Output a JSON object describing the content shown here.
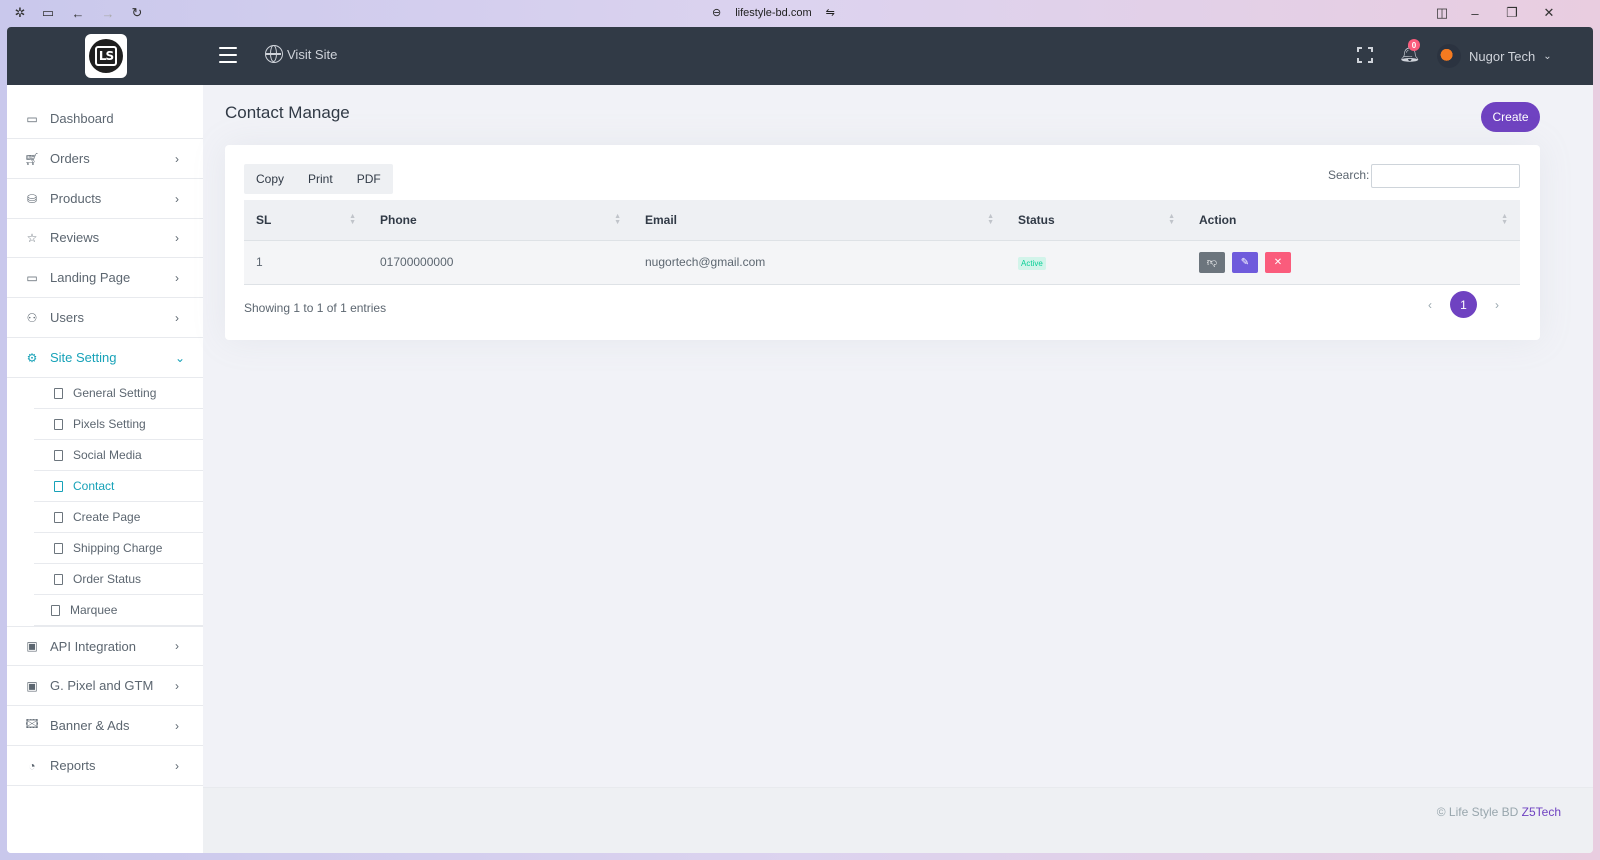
{
  "browser": {
    "url": "lifestyle-bd.com",
    "icons": [
      "extensions-icon",
      "sidebar-toggle-icon",
      "back-icon",
      "forward-icon",
      "reload-icon",
      "link-icon",
      "site-settings-icon",
      "split-view-icon",
      "minimize-icon",
      "restore-icon",
      "close-icon"
    ]
  },
  "topbar": {
    "logo_text": "LS",
    "visit_site": "Visit Site",
    "notification_count": "0",
    "user_name": "Nugor Tech",
    "user_caret": "⌄"
  },
  "sidebar": {
    "items": [
      {
        "label": "Dashboard",
        "icon": "monitor-icon",
        "chevron": ""
      },
      {
        "label": "Orders",
        "icon": "cart-icon",
        "chevron": "›"
      },
      {
        "label": "Products",
        "icon": "database-icon",
        "chevron": "›"
      },
      {
        "label": "Reviews",
        "icon": "star-icon",
        "chevron": "›"
      },
      {
        "label": "Landing Page",
        "icon": "monitor-icon",
        "chevron": "›"
      },
      {
        "label": "Users",
        "icon": "user-icon",
        "chevron": "›"
      },
      {
        "label": "Site Setting",
        "icon": "gear-icon",
        "chevron": "⌄"
      },
      {
        "label": "API Integration",
        "icon": "save-icon",
        "chevron": "›"
      },
      {
        "label": "G. Pixel and GTM",
        "icon": "save-icon",
        "chevron": "›"
      },
      {
        "label": "Banner & Ads",
        "icon": "image-icon",
        "chevron": "›"
      },
      {
        "label": "Reports",
        "icon": "pie-chart-icon",
        "chevron": "›"
      }
    ],
    "subitems": [
      {
        "label": "General Setting"
      },
      {
        "label": "Pixels Setting"
      },
      {
        "label": "Social Media"
      },
      {
        "label": "Contact"
      },
      {
        "label": "Create Page"
      },
      {
        "label": "Shipping Charge"
      },
      {
        "label": "Order Status"
      },
      {
        "label": "Marquee"
      }
    ]
  },
  "main": {
    "title": "Contact Manage",
    "create_label": "Create",
    "export_buttons": [
      "Copy",
      "Print",
      "PDF"
    ],
    "search_label": "Search:",
    "search_value": "",
    "columns": [
      "SL",
      "Phone",
      "Email",
      "Status",
      "Action"
    ],
    "rows": [
      {
        "sl": "1",
        "phone": "01700000000",
        "email": "nugortech@gmail.com",
        "status": "Active"
      }
    ],
    "info": "Showing 1 to 1 of 1 entries",
    "pagination": {
      "prev": "‹",
      "current": "1",
      "next": "›"
    }
  },
  "footer": {
    "text": "© Life Style BD",
    "link": "Z5Tech"
  },
  "colors": {
    "topbar": "#313a46",
    "accent": "#6f42c1",
    "active_menu": "#17a2b8",
    "danger": "#fa5c7c",
    "success": "#0acf97"
  }
}
